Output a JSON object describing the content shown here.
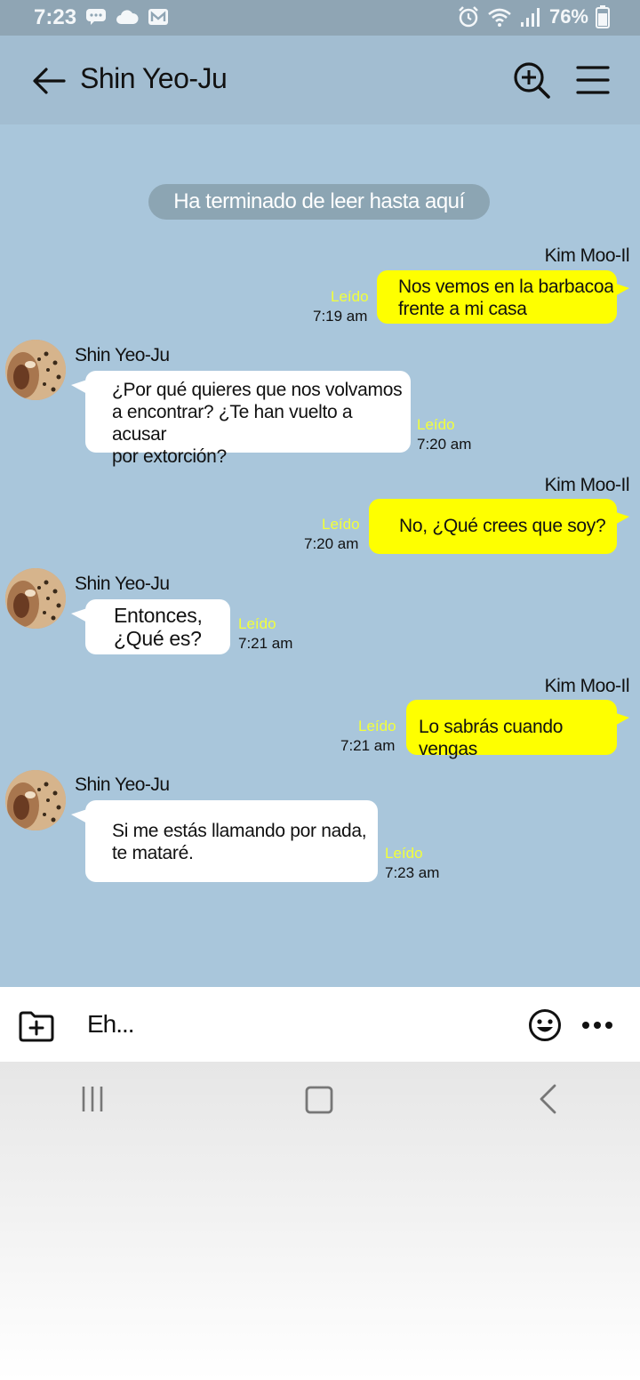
{
  "status_bar": {
    "time": "7:23",
    "battery": "76%"
  },
  "header": {
    "title": "Shin Yeo-Ju"
  },
  "chat": {
    "read_marker": "Ha terminado de leer hasta aquí",
    "messages": [
      {
        "direction": "out",
        "sender": "Kim Moo-Il",
        "lines": [
          "Nos vemos en la barbacoa",
          "frente a mi casa"
        ],
        "read": "Leído",
        "time": "7:19 am"
      },
      {
        "direction": "in",
        "sender": "Shin Yeo-Ju",
        "lines": [
          "¿Por qué quieres que nos volvamos",
          "a encontrar? ¿Te han vuelto a acusar",
          "por extorción?"
        ],
        "read": "Leído",
        "time": "7:20 am"
      },
      {
        "direction": "out",
        "sender": "Kim Moo-Il",
        "lines": [
          "No, ¿Qué crees que soy?"
        ],
        "read": "Leído",
        "time": "7:20 am"
      },
      {
        "direction": "in",
        "sender": "Shin Yeo-Ju",
        "lines": [
          "Entonces,",
          "¿Qué es?"
        ],
        "read": "Leído",
        "time": "7:21 am"
      },
      {
        "direction": "out",
        "sender": "Kim Moo-Il",
        "lines": [
          "Lo sabrás cuando vengas"
        ],
        "read": "Leído",
        "time": "7:21 am"
      },
      {
        "direction": "in",
        "sender": "Shin Yeo-Ju",
        "lines": [
          "Si me estás llamando por nada,",
          "te mataré."
        ],
        "read": "Leído",
        "time": "7:23 am"
      }
    ]
  },
  "input": {
    "value": "Eh..."
  },
  "icons": {
    "back": "arrow-left-icon",
    "search": "zoom-in-icon",
    "menu": "hamburger-icon",
    "attach": "folder-plus-icon",
    "emoji": "smiley-icon",
    "more": "more-dots-icon"
  },
  "colors": {
    "app_bar": "#a2bdd1",
    "chat_background": "#a9c6db",
    "outgoing_bubble": "#feff00",
    "incoming_bubble": "#ffffff",
    "read_label": "#f2ff3a",
    "read_marker": "#8ca5b3"
  }
}
